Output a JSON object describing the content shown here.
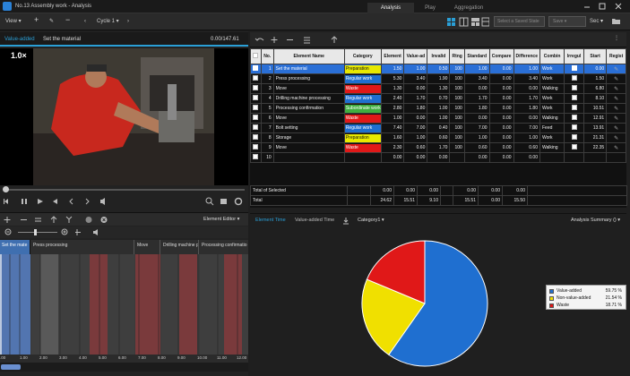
{
  "window": {
    "title": "No.13 Assembly work - Analysis"
  },
  "tabs": [
    "Analysis",
    "Play",
    "Aggregation"
  ],
  "toolbar": {
    "view_label": "View",
    "cycle_label": "Cycle 1",
    "save_state_placeholder": "Select a Saved State",
    "save_label": "Save",
    "time_unit": "Sec"
  },
  "value_added_panel": {
    "label": "Value-added",
    "element_name": "Set the material",
    "time": "0.00/147.61"
  },
  "video": {
    "speed": "1.0×"
  },
  "element_editor": {
    "title": "Element Editor"
  },
  "timeline": {
    "labels": [
      "Set the mate",
      "Press processing",
      "Move",
      "Drilling machine p",
      "Processing confirmatio"
    ],
    "ruler": [
      ".00",
      "1.00",
      "2.00",
      "3.00",
      "4.00",
      "5.00",
      "6.00",
      "7.00",
      "8.00",
      "9.00",
      "10.00",
      "11.00",
      "12.00"
    ]
  },
  "table": {
    "headers": [
      "",
      "No.",
      "Element Name",
      "Category",
      "Element",
      "Value-ad",
      "Invalid",
      "Rtng",
      "Standard",
      "Compare",
      "Difference",
      "Combin",
      "Irregul",
      "Start",
      "Regist"
    ],
    "rows": [
      {
        "no": "1",
        "name": "Set the material",
        "category": "Preparation",
        "cat_color": "#e8e800",
        "cat_text": "#111",
        "element": "1.50",
        "value_added": "1.00",
        "invalid": "0.50",
        "rating": "100",
        "standard": "1.00",
        "compare": "0.00",
        "difference": "1.00",
        "combin": "Work",
        "start": "0.00",
        "selected": true
      },
      {
        "no": "2",
        "name": "Press  processing",
        "category": "Regular work",
        "cat_color": "#1f6fd0",
        "cat_text": "#fff",
        "element": "5.30",
        "value_added": "3.40",
        "invalid": "1.90",
        "rating": "100",
        "standard": "3.40",
        "compare": "0.00",
        "difference": "3.40",
        "combin": "Work",
        "start": "1.50",
        "selected": false
      },
      {
        "no": "3",
        "name": "Move",
        "category": "Waste",
        "cat_color": "#e01818",
        "cat_text": "#fff",
        "element": "1.30",
        "value_added": "0.00",
        "invalid": "1.30",
        "rating": "100",
        "standard": "0.00",
        "compare": "0.00",
        "difference": "0.00",
        "combin": "Walking",
        "start": "6.80",
        "selected": false
      },
      {
        "no": "4",
        "name": "Drilling machine processing",
        "category": "Regular work",
        "cat_color": "#1f6fd0",
        "cat_text": "#fff",
        "element": "2.40",
        "value_added": "1.70",
        "invalid": "0.70",
        "rating": "100",
        "standard": "1.70",
        "compare": "0.00",
        "difference": "1.70",
        "combin": "Work",
        "start": "8.10",
        "selected": false
      },
      {
        "no": "5",
        "name": "Processing confirmation",
        "category": "Subordinate work",
        "cat_color": "#3fae3f",
        "cat_text": "#fff",
        "element": "2.80",
        "value_added": "1.80",
        "invalid": "1.00",
        "rating": "100",
        "standard": "1.80",
        "compare": "0.00",
        "difference": "1.80",
        "combin": "Work",
        "start": "10.51",
        "selected": false
      },
      {
        "no": "6",
        "name": "Move",
        "category": "Waste",
        "cat_color": "#e01818",
        "cat_text": "#fff",
        "element": "1.00",
        "value_added": "0.00",
        "invalid": "1.00",
        "rating": "100",
        "standard": "0.00",
        "compare": "0.00",
        "difference": "0.00",
        "combin": "Walking",
        "start": "12.91",
        "selected": false
      },
      {
        "no": "7",
        "name": "Bolt setting",
        "category": "Regular work",
        "cat_color": "#1f6fd0",
        "cat_text": "#fff",
        "element": "7.40",
        "value_added": "7.00",
        "invalid": "0.40",
        "rating": "100",
        "standard": "7.00",
        "compare": "0.00",
        "difference": "7.00",
        "combin": "Feed",
        "start": "13.91",
        "selected": false
      },
      {
        "no": "8",
        "name": "Storage",
        "category": "Preparation",
        "cat_color": "#e8e800",
        "cat_text": "#111",
        "element": "1.60",
        "value_added": "1.00",
        "invalid": "0.60",
        "rating": "100",
        "standard": "1.00",
        "compare": "0.00",
        "difference": "1.00",
        "combin": "Work",
        "start": "21.31",
        "selected": false
      },
      {
        "no": "9",
        "name": "Move",
        "category": "Waste",
        "cat_color": "#e01818",
        "cat_text": "#fff",
        "element": "2.30",
        "value_added": "0.60",
        "invalid": "1.70",
        "rating": "100",
        "standard": "0.60",
        "compare": "0.00",
        "difference": "0.60",
        "combin": "Walking",
        "start": "22.35",
        "selected": false
      },
      {
        "no": "10",
        "name": "",
        "category": "",
        "cat_color": "",
        "cat_text": "#fff",
        "element": "0.00",
        "value_added": "0.00",
        "invalid": "0.00",
        "rating": "",
        "standard": "0.00",
        "compare": "0.00",
        "difference": "0.00",
        "combin": "",
        "start": "",
        "selected": false
      }
    ],
    "total_selected": {
      "label": "Total of Selected",
      "element": "0.00",
      "value_added": "0.00",
      "invalid": "0.00",
      "standard": "0.00",
      "compare": "0.00",
      "difference": "0.00"
    },
    "total": {
      "label": "Total",
      "element": "24.62",
      "value_added": "15.51",
      "invalid": "9.10",
      "standard": "15.51",
      "compare": "0.00",
      "difference": "15.50"
    }
  },
  "analysis": {
    "tab_element_time": "Element Time",
    "tab_value_added_time": "Value-added Time",
    "category_dropdown": "Category1",
    "summary_dropdown": "Analysis Summary ()"
  },
  "chart_data": {
    "type": "pie",
    "title": "",
    "legend_position": "right",
    "slices": [
      {
        "name": "Value-added",
        "value": 59.75,
        "label": "59.75 %",
        "color": "#1f6fd0"
      },
      {
        "name": "Non-value-added",
        "value": 21.54,
        "label": "21.54 %",
        "color": "#f0e000"
      },
      {
        "name": "Waste",
        "value": 18.71,
        "label": "18.71 %",
        "color": "#e01818"
      }
    ]
  }
}
